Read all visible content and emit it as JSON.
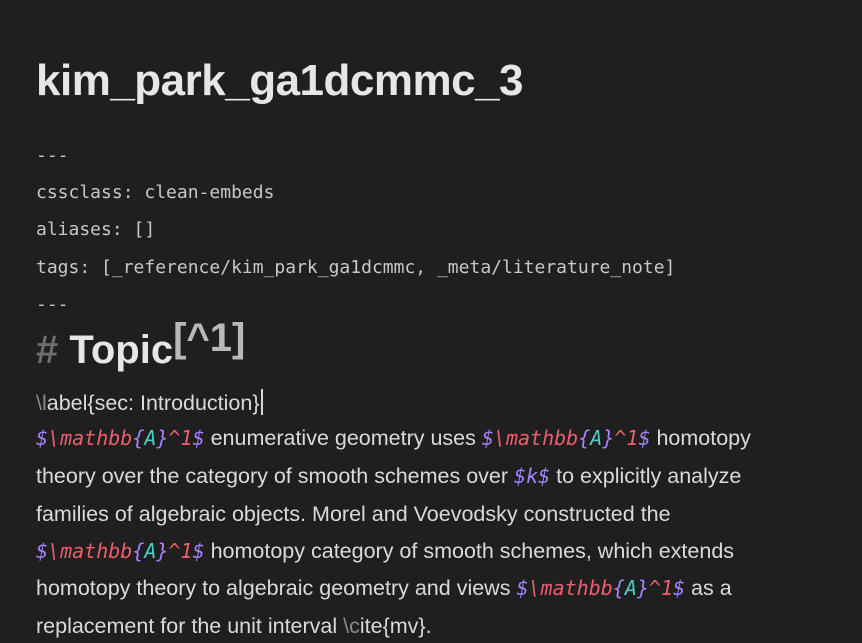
{
  "note": {
    "title": "kim_park_ga1dcmmc_3"
  },
  "frontmatter": {
    "open_delim": "---",
    "cssclass": "cssclass: clean-embeds",
    "aliases": "aliases: []",
    "tags": "tags: [_reference/kim_park_ga1dcmmc, _meta/literature_note]",
    "close_delim": "---"
  },
  "heading": {
    "hash": "#",
    "text": "Topic",
    "footnote": "[^1]"
  },
  "body": {
    "label_backslash": "\\",
    "label_l": "l",
    "label_rest": "abel{sec: Introduction}",
    "math_dollar": "$",
    "math_cmd": "\\mathbb",
    "math_open": "{",
    "math_var": "A",
    "math_close": "}",
    "math_sup": "^1",
    "math_k": "k",
    "line1_mid": " enumerative geometry uses ",
    "line1_end": " homotopy",
    "line2_start": "theory over the category of smooth schemes over ",
    "line2_end": " to explicitly analyze",
    "line3": "families of algebraic objects. Morel and Voevodsky constructed the",
    "line4_end": " homotopy category of smooth schemes, which extends",
    "line5_start": "homotopy theory to algebraic geometry and views ",
    "line5_end": " as a",
    "line6_start": "replacement for the unit interval ",
    "cite_backslash": "\\",
    "cite_c": "c",
    "cite_rest": "ite{mv}."
  },
  "colors": {
    "background": "#1f1f1f",
    "text": "#dadada",
    "math_delimiter": "#a682ff",
    "math_command": "#ef5e6e",
    "math_variable": "#4ecdc4"
  }
}
